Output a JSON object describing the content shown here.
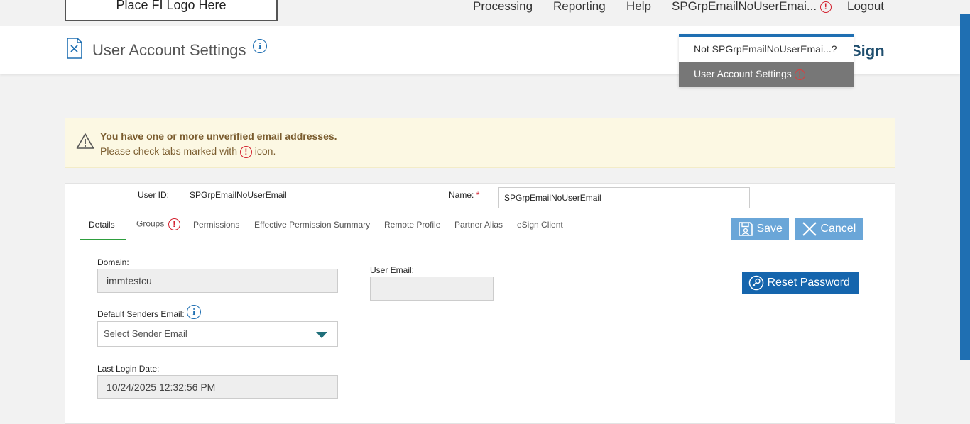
{
  "nav": {
    "logo": "Place FI Logo Here",
    "processing": "Processing",
    "reporting": "Reporting",
    "help": "Help",
    "user": "SPGrpEmailNoUserEmai...",
    "user_alert": "!",
    "logout": "Logout"
  },
  "header": {
    "title": "User Account Settings",
    "info": "i",
    "brand": "Sign"
  },
  "dropdown": {
    "items": [
      {
        "label": "Not SPGrpEmailNoUserEmai...?"
      },
      {
        "label": "User Account Settings",
        "alert": "!"
      }
    ]
  },
  "warning": {
    "title": "You have one or more unverified email addresses.",
    "text_before": "Please check tabs marked with",
    "alert": "!",
    "text_after": "icon."
  },
  "user": {
    "id_label": "User ID:",
    "id_value": "SPGrpEmailNoUserEmail",
    "name_label": "Name:",
    "required": "*",
    "name_value": "SPGrpEmailNoUserEmail"
  },
  "tabs": [
    {
      "label": "Details"
    },
    {
      "label": "Groups",
      "alert": "!"
    },
    {
      "label": "Permissions"
    },
    {
      "label": "Effective Permission Summary"
    },
    {
      "label": "Remote Profile"
    },
    {
      "label": "Partner Alias"
    },
    {
      "label": "eSign Client"
    }
  ],
  "buttons": {
    "save": "Save",
    "cancel": "Cancel",
    "reset": "Reset Password"
  },
  "details": {
    "domain_label": "Domain:",
    "domain_value": "immtestcu",
    "user_email_label": "User Email:",
    "user_email_value": "",
    "sender_label": "Default Senders Email:",
    "sender_info": "i",
    "sender_placeholder": "Select Sender Email",
    "last_login_label": "Last Login Date:",
    "last_login_value": "10/24/2025 12:32:56 PM"
  },
  "colors": {
    "accent": "#1f6fb2",
    "alert": "#d3202e",
    "warning_bg": "#fcf8e3",
    "tab_active": "#2e9e3e"
  }
}
